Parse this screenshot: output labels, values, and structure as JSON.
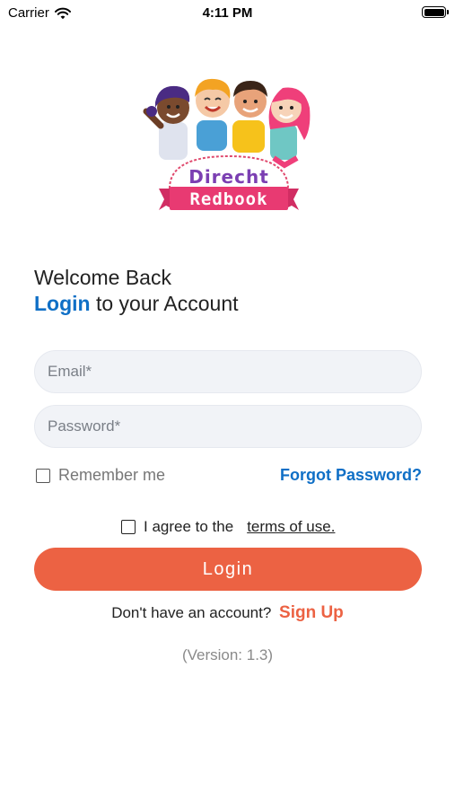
{
  "status_bar": {
    "carrier": "Carrier",
    "time": "4:11 PM",
    "battery_level": 1.0,
    "wifi_icon": "wifi-icon",
    "battery_icon": "battery-icon"
  },
  "logo": {
    "line1": "Direcht",
    "line2": "Redbook"
  },
  "header": {
    "welcome": "Welcome Back",
    "login_accent": "Login",
    "login_rest": " to your Account"
  },
  "form": {
    "email_placeholder": "Email*",
    "email_value": "",
    "password_placeholder": "Password*",
    "password_value": "",
    "remember_label": "Remember me",
    "remember_checked": false,
    "forgot_label": "Forgot Password?",
    "terms_prefix": "I agree to the",
    "terms_link": "terms of use.",
    "terms_checked": false,
    "login_button": "Login"
  },
  "signup": {
    "prompt": "Don't have an account?",
    "link": "Sign Up"
  },
  "version": "(Version: 1.3)",
  "colors": {
    "accent_blue": "#0f6fc6",
    "accent_orange": "#ec6243",
    "field_bg": "#f1f3f7"
  }
}
